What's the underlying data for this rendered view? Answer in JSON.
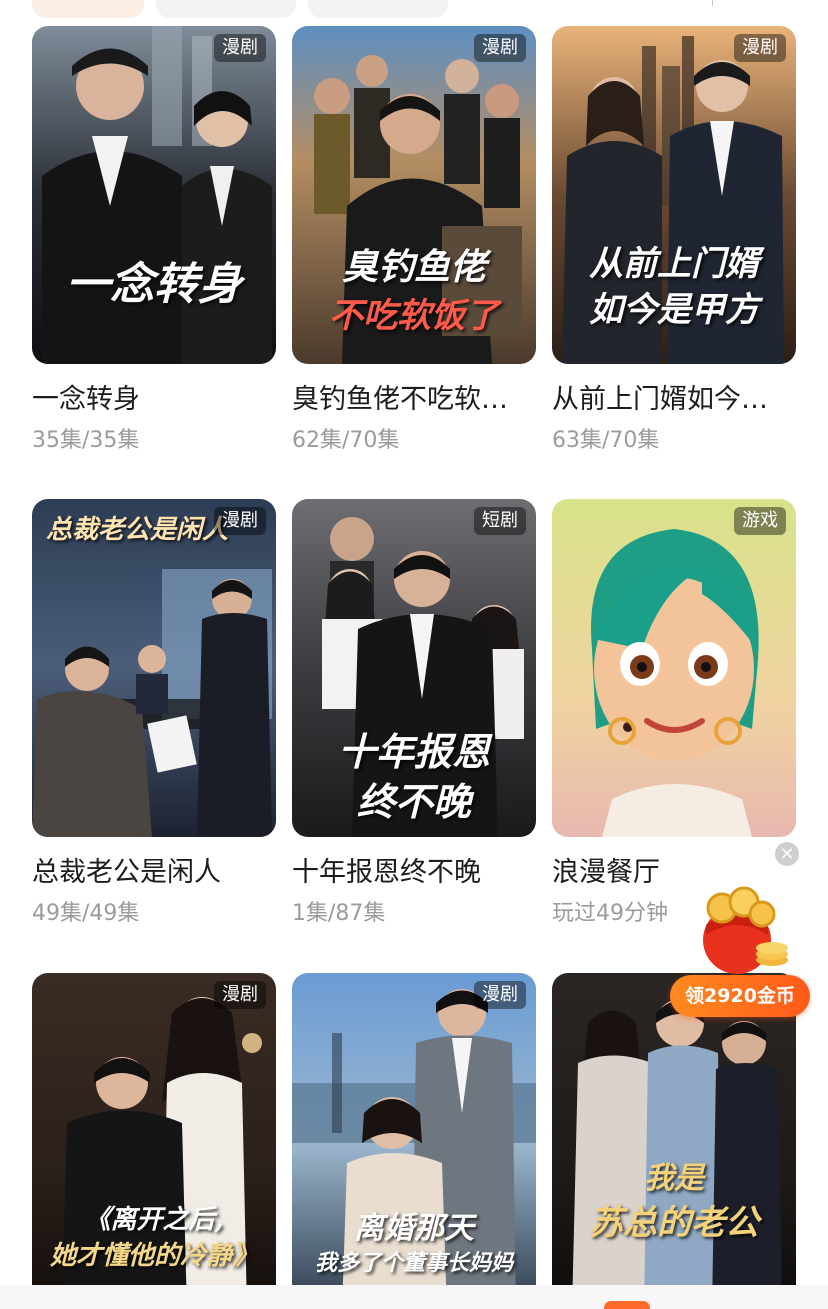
{
  "cards": [
    {
      "tag": "漫剧",
      "cover_text_1": "一念转身",
      "cover_text_2": "",
      "title": "一念转身",
      "sub": "35集/35集"
    },
    {
      "tag": "漫剧",
      "cover_text_1": "臭钓鱼佬",
      "cover_text_2": "不吃软饭了",
      "title": "臭钓鱼佬不吃软…",
      "sub": "62集/70集"
    },
    {
      "tag": "漫剧",
      "cover_text_1": "从前上门婿",
      "cover_text_2": "如今是甲方",
      "title": "从前上门婿如今…",
      "sub": "63集/70集"
    },
    {
      "tag": "漫剧",
      "cover_text_1": "总裁老公是闲人",
      "cover_text_2": "",
      "title": "总裁老公是闲人",
      "sub": "49集/49集"
    },
    {
      "tag": "短剧",
      "cover_text_1": "十年报恩",
      "cover_text_2": "终不晚",
      "title": "十年报恩终不晚",
      "sub": "1集/87集"
    },
    {
      "tag": "游戏",
      "cover_text_1": "",
      "cover_text_2": "",
      "title": "浪漫餐厅",
      "sub": "玩过49分钟"
    },
    {
      "tag": "漫剧",
      "cover_text_1": "《离开之后,",
      "cover_text_2": "她才懂他的冷静》",
      "title": "",
      "sub": ""
    },
    {
      "tag": "漫剧",
      "cover_text_1": "离婚那天",
      "cover_text_2": "我多了个董事长妈妈",
      "title": "",
      "sub": ""
    },
    {
      "tag": "",
      "cover_text_1": "我是",
      "cover_text_2": "苏总的老公",
      "title": "",
      "sub": ""
    }
  ],
  "reward": {
    "label": "领2920金币",
    "close_icon": "close-icon",
    "bag_icon": "red-envelope-coin-icon"
  },
  "colors": {
    "accent": "#ff6a1e",
    "tag_bg": "rgba(0,0,0,0.42)",
    "sub_text": "#9b9b9b"
  }
}
